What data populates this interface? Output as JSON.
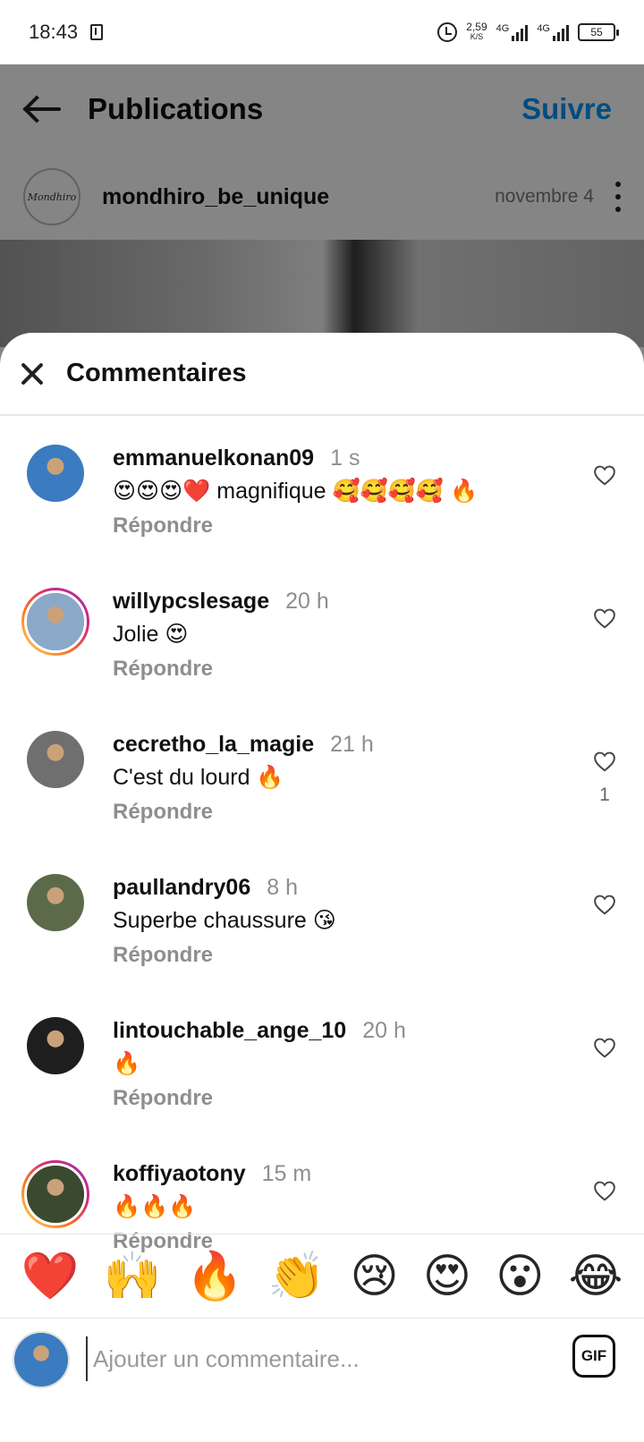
{
  "status_bar": {
    "time": "18:43",
    "speed_value": "2,59",
    "speed_unit": "K/S",
    "network_1": "4G",
    "network_2": "4G",
    "battery": "55"
  },
  "header": {
    "title": "Publications",
    "follow_label": "Suivre"
  },
  "post": {
    "author": "mondhiro_be_unique",
    "avatar_text": "Mondhiro",
    "date": "novembre 4"
  },
  "sheet": {
    "title": "Commentaires"
  },
  "comments": [
    {
      "user": "emmanuelkonan09",
      "time": "1 s",
      "text": "😍😍😍❤️ magnifique 🥰🥰🥰🥰 🔥",
      "reply": "Répondre",
      "likes": "",
      "story": false,
      "avatar_color": "#3b7bbf"
    },
    {
      "user": "willypcslesage",
      "time": "20 h",
      "text": "Jolie 😍",
      "reply": "Répondre",
      "likes": "",
      "story": true,
      "avatar_color": "#8aa9c8"
    },
    {
      "user": "cecretho_la_magie",
      "time": "21 h",
      "text": "C'est du lourd 🔥",
      "reply": "Répondre",
      "likes": "1",
      "story": false,
      "avatar_color": "#6f6f6f"
    },
    {
      "user": "paullandry06",
      "time": "8 h",
      "text": "Superbe chaussure 😘",
      "reply": "Répondre",
      "likes": "",
      "story": false,
      "avatar_color": "#5b6b4a"
    },
    {
      "user": "lintouchable_ange_10",
      "time": "20 h",
      "text": "🔥",
      "reply": "Répondre",
      "likes": "",
      "story": false,
      "avatar_color": "#1e1e1e"
    },
    {
      "user": "koffiyaotony",
      "time": "15 m",
      "text": "🔥🔥🔥",
      "reply": "Répondre",
      "likes": "",
      "story": true,
      "avatar_color": "#3a4a2f"
    }
  ],
  "emoji_bar": [
    "❤️",
    "🙌",
    "🔥",
    "👏",
    "😢",
    "😍",
    "😮",
    "😂"
  ],
  "input": {
    "placeholder": "Ajouter un commentaire...",
    "gif_label": "GIF"
  },
  "colors": {
    "link_blue": "#0095f6",
    "secondary_text": "#8e8e8e",
    "story_ring": [
      "#feda75",
      "#fa7e1e",
      "#d62976",
      "#962fbf"
    ]
  }
}
